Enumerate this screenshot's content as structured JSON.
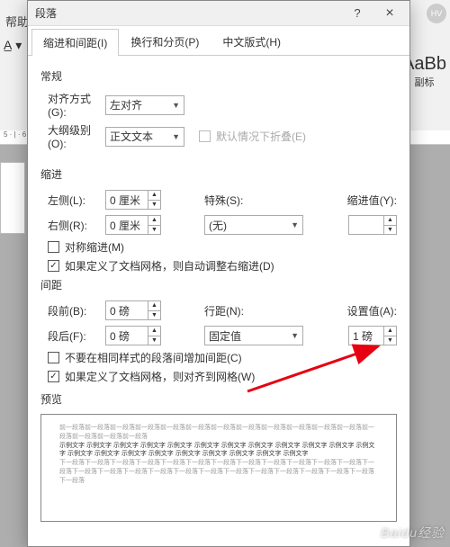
{
  "bg": {
    "help": "帮助",
    "style_name": "AaBb",
    "style_sub": "副标",
    "ruler": "5 · | · 6"
  },
  "dialog": {
    "title": "段落",
    "help_btn": "?",
    "close_btn": "×",
    "tabs": [
      "缩进和间距(I)",
      "换行和分页(P)",
      "中文版式(H)"
    ],
    "general": {
      "title": "常规",
      "align_label": "对齐方式(G):",
      "align_value": "左对齐",
      "outline_label": "大纲级别(O):",
      "outline_value": "正文文本",
      "collapse_label": "默认情况下折叠(E)"
    },
    "indent": {
      "title": "缩进",
      "left_label": "左侧(L):",
      "left_value": "0 厘米",
      "right_label": "右侧(R):",
      "right_value": "0 厘米",
      "special_label": "特殊(S):",
      "special_value": "(无)",
      "by_label": "缩进值(Y):",
      "by_value": "",
      "mirror": "对称缩进(M)",
      "grid": "如果定义了文档网格，则自动调整右缩进(D)"
    },
    "spacing": {
      "title": "间距",
      "before_label": "段前(B):",
      "before_value": "0 磅",
      "after_label": "段后(F):",
      "after_value": "0 磅",
      "line_label": "行距(N):",
      "line_value": "固定值",
      "at_label": "设置值(A):",
      "at_value": "1 磅",
      "no_space": "不要在相同样式的段落间增加间距(C)",
      "grid": "如果定义了文档网格，则对齐到网格(W)"
    },
    "preview": {
      "title": "预览",
      "before": "前一段落前一段落前一段落前一段落前一段落前一段落前一段落前一段落前一段落前一段落前一段落前一段落前一段落前一段落前一段落前一段落",
      "sample": "示例文字 示例文字 示例文字 示例文字 示例文字 示例文字 示例文字 示例文字 示例文字 示例文字 示例文字 示例文字 示例文字 示例文字 示例文字 示例文字 示例文字 示例文字 示例文字 示例文字 示例文字",
      "after": "下一段落下一段落下一段落下一段落下一段落下一段落下一段落下一段落下一段落下一段落下一段落下一段落下一段落下一段落下一段落下一段落下一段落下一段落下一段落下一段落下一段落下一段落下一段落下一段落下一段落下一段落"
    }
  },
  "watermark": "Baidu经验",
  "avatar": "HV"
}
